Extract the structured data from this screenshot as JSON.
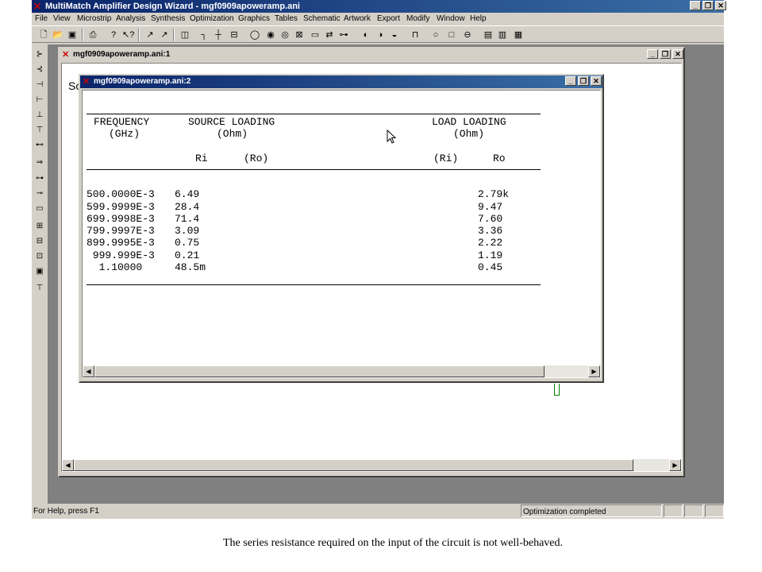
{
  "app": {
    "title": "MultiMatch Amplifier Design Wizard - mgf0909apoweramp.ani",
    "menu": [
      "File",
      "View",
      "Microstrip",
      "Analysis",
      "Synthesis",
      "Optimization",
      "Graphics",
      "Tables",
      "Schematic",
      "Artwork",
      "Export",
      "Modify",
      "Window",
      "Help"
    ],
    "status_left": "For Help, press F1",
    "status_right": "Optimization completed"
  },
  "window1": {
    "title": "mgf0909apoweramp.ani:1",
    "visible_text": "Sc"
  },
  "window2": {
    "title": "mgf0909apoweramp.ani:2",
    "header": {
      "col1": "FREQUENCY",
      "col1_unit": "(GHz)",
      "col2": "SOURCE LOADING",
      "col2_unit": "(Ohm)",
      "col3": "LOAD LOADING",
      "col3_unit": "(Ohm)",
      "sub_ri": "Ri",
      "sub_ro": "(Ro)",
      "sub_ri2": "(Ri)",
      "sub_ro2": "Ro"
    },
    "rows": [
      {
        "freq": "500.0000E-3",
        "src": "6.49",
        "load": "2.79k"
      },
      {
        "freq": "599.9999E-3",
        "src": "28.4",
        "load": "9.47"
      },
      {
        "freq": "699.9998E-3",
        "src": "71.4",
        "load": "7.60"
      },
      {
        "freq": "799.9997E-3",
        "src": "3.09",
        "load": "3.36"
      },
      {
        "freq": "899.9995E-3",
        "src": "0.75",
        "load": "2.22"
      },
      {
        "freq": " 999.999E-3",
        "src": "0.21",
        "load": "1.19"
      },
      {
        "freq": "  1.10000",
        "src": "48.5m",
        "load": "0.45"
      }
    ]
  },
  "caption": "The series resistance required on the input of the circuit is not well-behaved."
}
